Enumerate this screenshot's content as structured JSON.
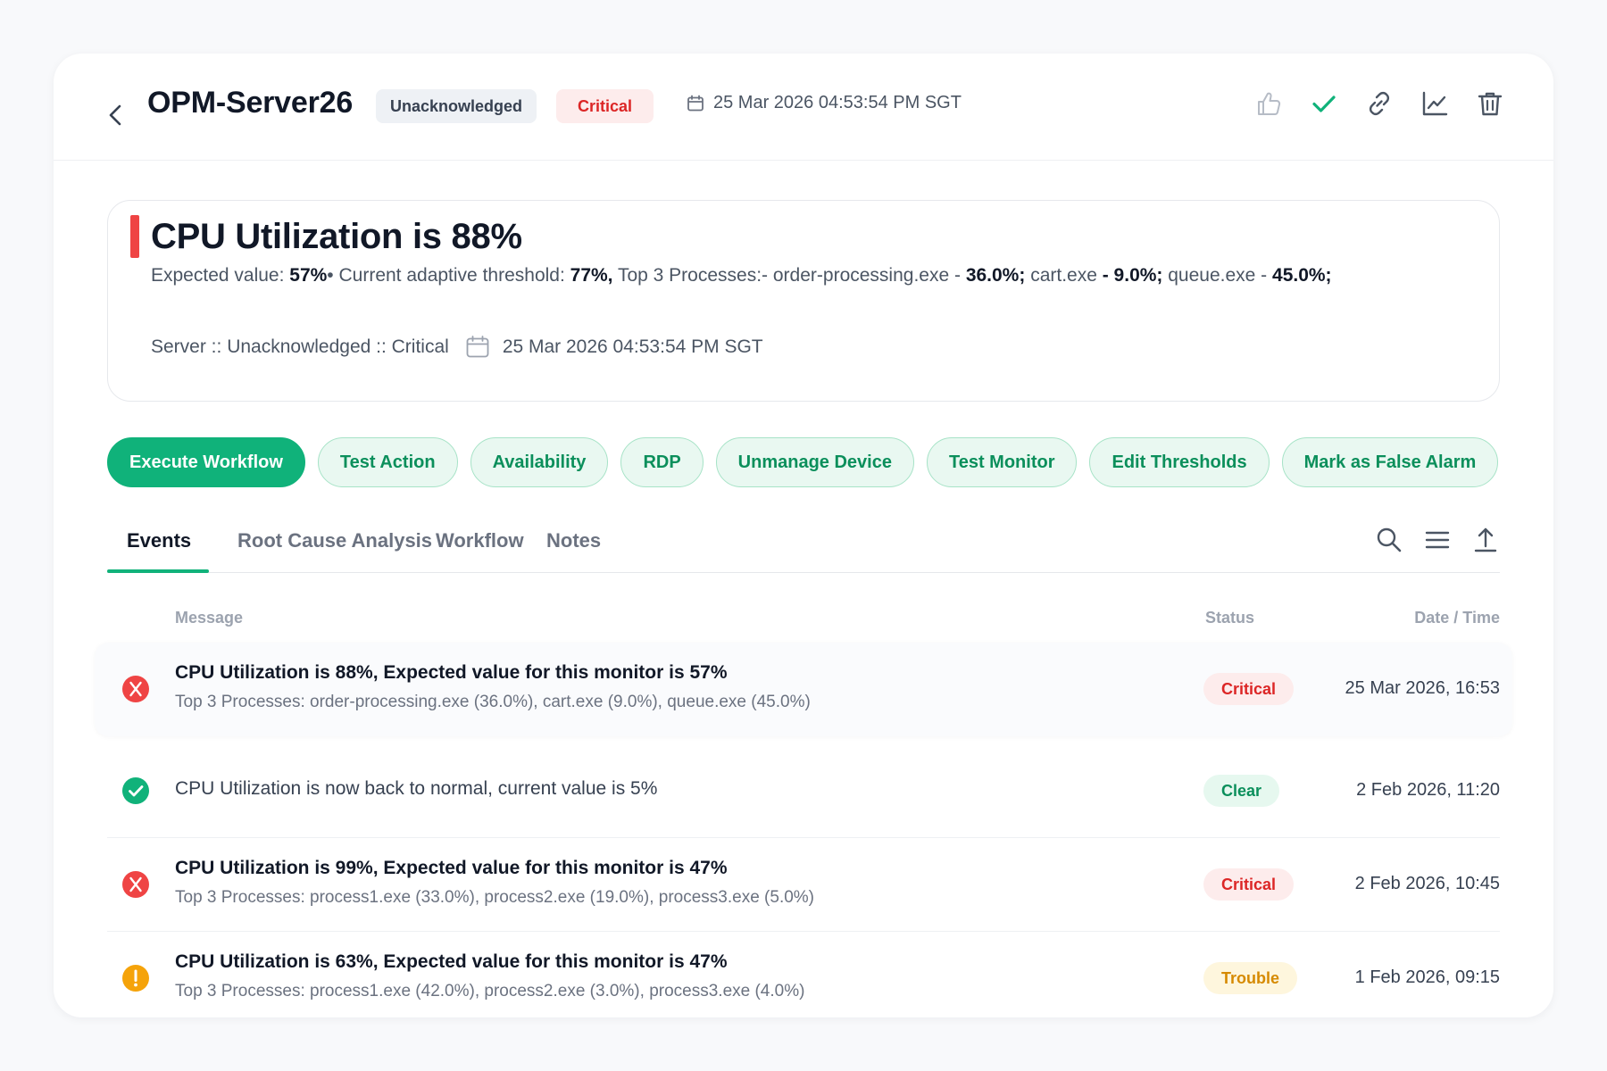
{
  "header": {
    "server_name": "OPM-Server26",
    "ack_status": "Unacknowledged",
    "severity": "Critical",
    "datetime": "25 Mar 2026 04:53:54 PM SGT",
    "actions": [
      "thumbs-up-icon",
      "check-icon",
      "link-icon",
      "chart-line-icon",
      "trash-icon"
    ]
  },
  "summary": {
    "title": "CPU Utilization is 88%",
    "details": {
      "expected_label": "Expected value: ",
      "expected_value": "57%",
      "sep1": "• Current adaptive threshold: ",
      "threshold_value": "77%,",
      "top3_label": " Top 3 Processes:- order-processing.exe - ",
      "p1_value": "36.0%;",
      "p2_label": " cart.exe ",
      "p2_value": "- 9.0%;",
      "p3_label": " queue.exe - ",
      "p3_value": "45.0%;"
    },
    "meta_text": "Server :: Unacknowledged :: Critical",
    "meta_datetime": "25 Mar 2026 04:53:54 PM SGT"
  },
  "actions": {
    "execute_workflow": "Execute Workflow",
    "test_action": "Test Action",
    "availability": "Availability",
    "rdp": "RDP",
    "unmanage_device": "Unmanage Device",
    "test_monitor": "Test Monitor",
    "edit_thresholds": "Edit Thresholds",
    "mark_false_alarm": "Mark as False Alarm"
  },
  "tabs": {
    "events": "Events",
    "rca": "Root Cause Analysis",
    "workflow": "Workflow",
    "notes": "Notes",
    "tools": [
      "search-icon",
      "menu-icon",
      "upload-icon"
    ]
  },
  "table": {
    "col_message": "Message",
    "col_status": "Status",
    "col_datetime": "Date / Time",
    "rows": [
      {
        "title": "CPU Utilization is 88%, Expected value for this monitor is 57%",
        "detail": "Top 3 Processes: order-processing.exe (36.0%), cart.exe (9.0%), queue.exe (45.0%)",
        "status": "Critical",
        "datetime": "25 Mar 2026, 16:53"
      },
      {
        "title": "CPU Utilization is now back to normal, current value is 5%",
        "status": "Clear",
        "datetime": "2 Feb 2026, 11:20"
      },
      {
        "title": "CPU Utilization is 99%, Expected value for this monitor is 47%",
        "detail": "Top 3 Processes: process1.exe (33.0%), process2.exe (19.0%), process3.exe (5.0%)",
        "status": "Critical",
        "datetime": "2 Feb 2026, 10:45"
      },
      {
        "title": "CPU Utilization is 63%, Expected value for this monitor is 47%",
        "detail": "Top 3 Processes: process1.exe (42.0%), process2.exe (3.0%), process3.exe (4.0%)",
        "status": "Trouble",
        "datetime": "1 Feb 2026, 09:15"
      }
    ]
  },
  "colors": {
    "accent": "#10b27a",
    "critical": "#dc2626",
    "critical_icon": "#ef4444",
    "clear": "#0b8f5b",
    "trouble": "#f5a30a"
  }
}
